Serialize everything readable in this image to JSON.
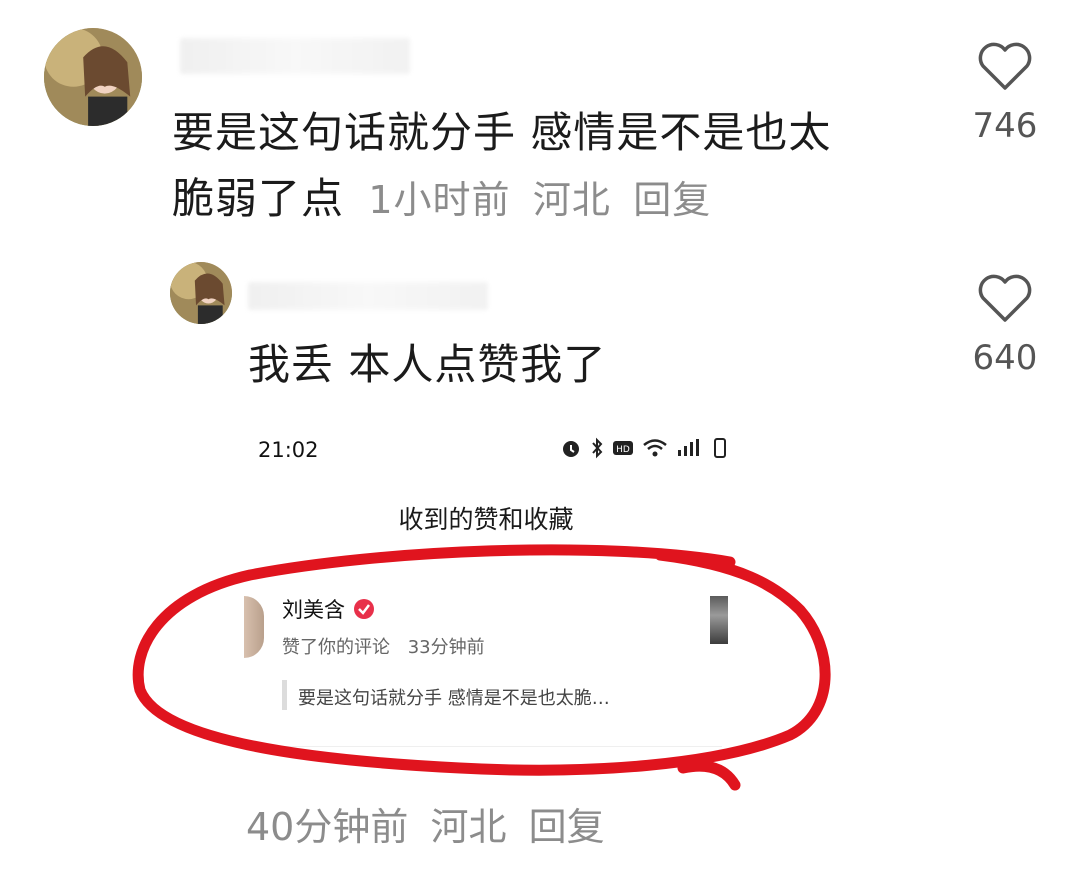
{
  "comments": [
    {
      "text_line1": "要是这句话就分手 感情是不是也太",
      "text_line2": "脆弱了点",
      "time": "1小时前",
      "location": "河北",
      "reply": "回复",
      "likes": "746"
    },
    {
      "text": "我丢 本人点赞我了",
      "likes": "640"
    }
  ],
  "screenshot": {
    "time": "21:02",
    "header": "收到的赞和收藏",
    "notification": {
      "name": "刘美含",
      "action": "赞了你的评论",
      "ago": "33分钟前",
      "quote": "要是这句话就分手 感情是不是也太脆…"
    }
  },
  "footer": {
    "time": "40分钟前",
    "location": "河北",
    "reply": "回复"
  },
  "colors": {
    "annotation_red": "#e0141e",
    "verified_red": "#e8304a",
    "meta_gray": "#8c8c8c"
  }
}
